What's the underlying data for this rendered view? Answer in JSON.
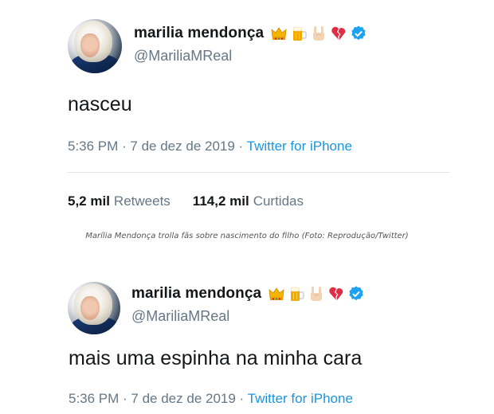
{
  "tweets": [
    {
      "display_name": "marilia mendonça",
      "handle": "@MariliaMReal",
      "emojis": [
        "crown-emoji",
        "beer-emoji",
        "sign-of-horns-emoji",
        "broken-heart-emoji"
      ],
      "verified": true,
      "text": "nasceu",
      "time": "5:36 PM · 7 de dez de 2019 · ",
      "source": "Twitter for iPhone",
      "retweets_count": "5,2 mil",
      "retweets_label": "Retweets",
      "likes_count": "114,2 mil",
      "likes_label": "Curtidas"
    },
    {
      "display_name": "marilia mendonça",
      "handle": "@MariliaMReal",
      "emojis": [
        "crown-emoji",
        "beer-emoji",
        "sign-of-horns-emoji",
        "broken-heart-emoji"
      ],
      "verified": true,
      "text": "mais uma espinha na minha cara",
      "time": "5:36 PM · 7 de dez de 2019 · ",
      "source": "Twitter for iPhone"
    }
  ],
  "caption": "Marília Mendonça trolla fãs sobre nascimento do filho (Foto: Reprodução/Twitter)",
  "colors": {
    "text": "#14171a",
    "secondary": "#657786",
    "link": "#1b95e0",
    "verified": "#1da1f2",
    "divider": "#e1e8ed"
  }
}
